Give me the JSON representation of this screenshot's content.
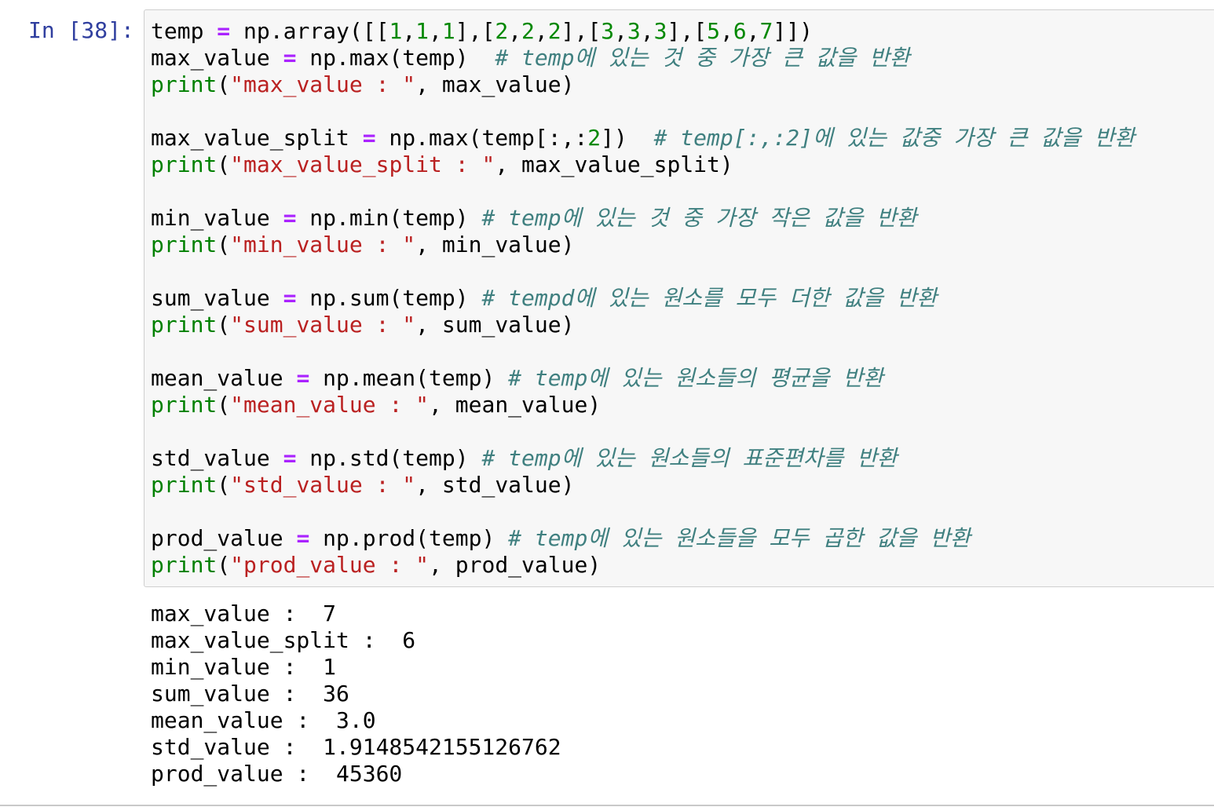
{
  "prompt": "In [38]:",
  "code_lines": [
    [
      {
        "t": "temp "
      },
      {
        "t": "=",
        "c": "t-op"
      },
      {
        "t": " np.array([["
      },
      {
        "t": "1",
        "c": "t-num"
      },
      {
        "t": ","
      },
      {
        "t": "1",
        "c": "t-num"
      },
      {
        "t": ","
      },
      {
        "t": "1",
        "c": "t-num"
      },
      {
        "t": "],["
      },
      {
        "t": "2",
        "c": "t-num"
      },
      {
        "t": ","
      },
      {
        "t": "2",
        "c": "t-num"
      },
      {
        "t": ","
      },
      {
        "t": "2",
        "c": "t-num"
      },
      {
        "t": "],["
      },
      {
        "t": "3",
        "c": "t-num"
      },
      {
        "t": ","
      },
      {
        "t": "3",
        "c": "t-num"
      },
      {
        "t": ","
      },
      {
        "t": "3",
        "c": "t-num"
      },
      {
        "t": "],["
      },
      {
        "t": "5",
        "c": "t-num"
      },
      {
        "t": ","
      },
      {
        "t": "6",
        "c": "t-num"
      },
      {
        "t": ","
      },
      {
        "t": "7",
        "c": "t-num"
      },
      {
        "t": "]])"
      }
    ],
    [
      {
        "t": "max_value "
      },
      {
        "t": "=",
        "c": "t-op"
      },
      {
        "t": " np.max(temp)  "
      },
      {
        "t": "# temp에 있는 것 중 가장 큰 값을 반환",
        "c": "t-com"
      }
    ],
    [
      {
        "t": "print",
        "c": "t-builtin"
      },
      {
        "t": "("
      },
      {
        "t": "\"max_value : \"",
        "c": "t-str"
      },
      {
        "t": ", max_value)"
      }
    ],
    [],
    [
      {
        "t": "max_value_split "
      },
      {
        "t": "=",
        "c": "t-op"
      },
      {
        "t": " np.max(temp[:,:"
      },
      {
        "t": "2",
        "c": "t-num"
      },
      {
        "t": "])  "
      },
      {
        "t": "# temp[:,:2]에 있는 값중 가장 큰 값을 반환",
        "c": "t-com"
      }
    ],
    [
      {
        "t": "print",
        "c": "t-builtin"
      },
      {
        "t": "("
      },
      {
        "t": "\"max_value_split : \"",
        "c": "t-str"
      },
      {
        "t": ", max_value_split)"
      }
    ],
    [],
    [
      {
        "t": "min_value "
      },
      {
        "t": "=",
        "c": "t-op"
      },
      {
        "t": " np.min(temp) "
      },
      {
        "t": "# temp에 있는 것 중 가장 작은 값을 반환",
        "c": "t-com"
      }
    ],
    [
      {
        "t": "print",
        "c": "t-builtin"
      },
      {
        "t": "("
      },
      {
        "t": "\"min_value : \"",
        "c": "t-str"
      },
      {
        "t": ", min_value)"
      }
    ],
    [],
    [
      {
        "t": "sum_value "
      },
      {
        "t": "=",
        "c": "t-op"
      },
      {
        "t": " np.sum(temp) "
      },
      {
        "t": "# tempd에 있는 원소를 모두 더한 값을 반환",
        "c": "t-com"
      }
    ],
    [
      {
        "t": "print",
        "c": "t-builtin"
      },
      {
        "t": "("
      },
      {
        "t": "\"sum_value : \"",
        "c": "t-str"
      },
      {
        "t": ", sum_value)"
      }
    ],
    [],
    [
      {
        "t": "mean_value "
      },
      {
        "t": "=",
        "c": "t-op"
      },
      {
        "t": " np.mean(temp) "
      },
      {
        "t": "# temp에 있는 원소들의 평균을 반환",
        "c": "t-com"
      }
    ],
    [
      {
        "t": "print",
        "c": "t-builtin"
      },
      {
        "t": "("
      },
      {
        "t": "\"mean_value : \"",
        "c": "t-str"
      },
      {
        "t": ", mean_value)"
      }
    ],
    [],
    [
      {
        "t": "std_value "
      },
      {
        "t": "=",
        "c": "t-op"
      },
      {
        "t": " np.std(temp) "
      },
      {
        "t": "# temp에 있는 원소들의 표준편차를 반환",
        "c": "t-com"
      }
    ],
    [
      {
        "t": "print",
        "c": "t-builtin"
      },
      {
        "t": "("
      },
      {
        "t": "\"std_value : \"",
        "c": "t-str"
      },
      {
        "t": ", std_value)"
      }
    ],
    [],
    [
      {
        "t": "prod_value "
      },
      {
        "t": "=",
        "c": "t-op"
      },
      {
        "t": " np.prod(temp) "
      },
      {
        "t": "# temp에 있는 원소들을 모두 곱한 값을 반환",
        "c": "t-com"
      }
    ],
    [
      {
        "t": "print",
        "c": "t-builtin"
      },
      {
        "t": "("
      },
      {
        "t": "\"prod_value : \"",
        "c": "t-str"
      },
      {
        "t": ", prod_value)"
      }
    ]
  ],
  "output_lines": [
    "max_value :  7",
    "max_value_split :  6",
    "min_value :  1",
    "sum_value :  36",
    "mean_value :  3.0",
    "std_value :  1.9148542155126762",
    "prod_value :  45360"
  ],
  "colors": {
    "prompt": "#303f9f",
    "operator": "#aa22ff",
    "number": "#008800",
    "builtin": "#008000",
    "string": "#ba2121",
    "comment": "#408080",
    "input_bg": "#f7f7f7"
  }
}
